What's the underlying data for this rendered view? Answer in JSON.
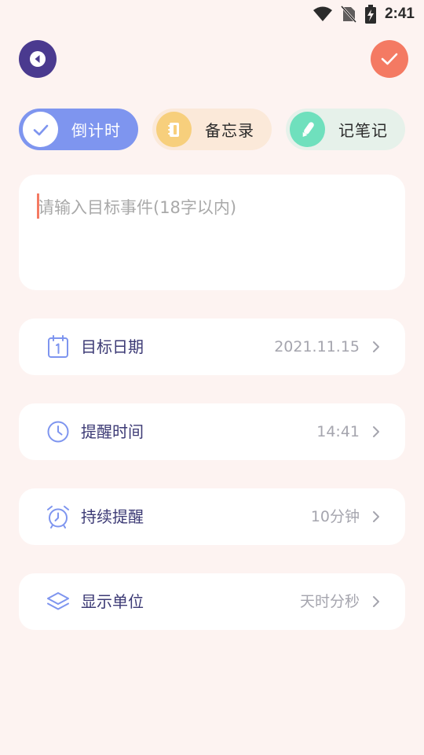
{
  "status_bar": {
    "time": "2:41"
  },
  "header": {
    "back_icon": "back-arrow-icon",
    "confirm_icon": "check-icon"
  },
  "tabs": [
    {
      "label": "倒计时",
      "icon": "check-icon",
      "selected": true
    },
    {
      "label": "备忘录",
      "icon": "notebook-icon",
      "selected": false
    },
    {
      "label": "记笔记",
      "icon": "pen-icon",
      "selected": false
    }
  ],
  "event": {
    "placeholder": "请输入目标事件(18字以内)",
    "value": ""
  },
  "settings": [
    {
      "label": "目标日期",
      "value": "2021.11.15",
      "icon": "calendar-icon"
    },
    {
      "label": "提醒时间",
      "value": "14:41",
      "icon": "clock-icon"
    },
    {
      "label": "持续提醒",
      "value": "10分钟",
      "icon": "alarm-icon"
    },
    {
      "label": "显示单位",
      "value": "天时分秒",
      "icon": "layers-icon"
    }
  ],
  "colors": {
    "background": "#FDF3F1",
    "primary": "#4A3A8F",
    "accent": "#F47A63",
    "tab_countdown": "#7E95EF",
    "tab_memo": "#F7CF7C",
    "tab_note": "#6FE0BD"
  }
}
